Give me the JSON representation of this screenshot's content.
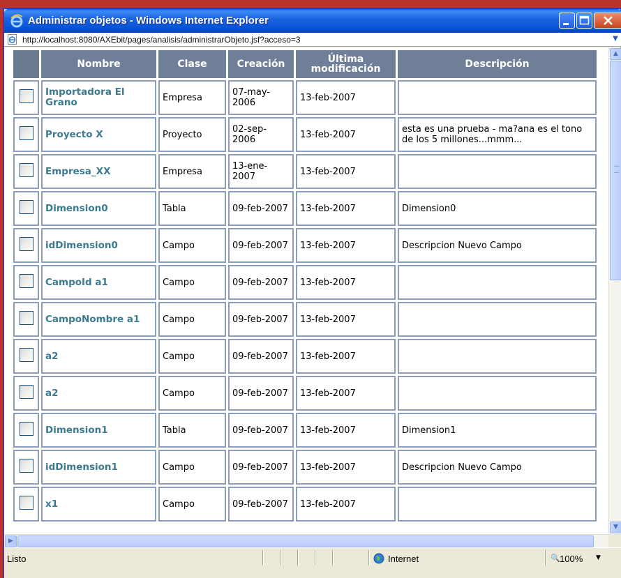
{
  "window": {
    "title": "Administrar objetos - Windows Internet Explorer"
  },
  "address": {
    "url": "http://localhost:8080/AXEbit/pages/analisis/administrarObjeto.jsf?acceso=3"
  },
  "table": {
    "headers": {
      "nombre": "Nombre",
      "clase": "Clase",
      "creacion": "Creación",
      "ultima_modificacion": "Última modificación",
      "descripcion": "Descripción"
    },
    "rows": [
      {
        "nombre": "Importadora El Grano",
        "clase": "Empresa",
        "creacion": "07-may-2006",
        "modificacion": "13-feb-2007",
        "descripcion": ""
      },
      {
        "nombre": "Proyecto X",
        "clase": "Proyecto",
        "creacion": "02-sep-2006",
        "modificacion": "13-feb-2007",
        "descripcion": "esta es una prueba - ma?ana es el tono de los 5 millones...mmm..."
      },
      {
        "nombre": "Empresa_XX",
        "clase": "Empresa",
        "creacion": "13-ene-2007",
        "modificacion": "13-feb-2007",
        "descripcion": ""
      },
      {
        "nombre": "Dimension0",
        "clase": "Tabla",
        "creacion": "09-feb-2007",
        "modificacion": "13-feb-2007",
        "descripcion": "Dimension0"
      },
      {
        "nombre": "idDimension0",
        "clase": "Campo",
        "creacion": "09-feb-2007",
        "modificacion": "13-feb-2007",
        "descripcion": "Descripcion Nuevo Campo"
      },
      {
        "nombre": "CampoId a1",
        "clase": "Campo",
        "creacion": "09-feb-2007",
        "modificacion": "13-feb-2007",
        "descripcion": ""
      },
      {
        "nombre": "CampoNombre a1",
        "clase": "Campo",
        "creacion": "09-feb-2007",
        "modificacion": "13-feb-2007",
        "descripcion": ""
      },
      {
        "nombre": "a2",
        "clase": "Campo",
        "creacion": "09-feb-2007",
        "modificacion": "13-feb-2007",
        "descripcion": ""
      },
      {
        "nombre": "a2",
        "clase": "Campo",
        "creacion": "09-feb-2007",
        "modificacion": "13-feb-2007",
        "descripcion": ""
      },
      {
        "nombre": "Dimension1",
        "clase": "Tabla",
        "creacion": "09-feb-2007",
        "modificacion": "13-feb-2007",
        "descripcion": "Dimension1"
      },
      {
        "nombre": "idDimension1",
        "clase": "Campo",
        "creacion": "09-feb-2007",
        "modificacion": "13-feb-2007",
        "descripcion": "Descripcion Nuevo Campo"
      },
      {
        "nombre": "x1",
        "clase": "Campo",
        "creacion": "09-feb-2007",
        "modificacion": "13-feb-2007",
        "descripcion": ""
      }
    ]
  },
  "status": {
    "text": "Listo",
    "zone": "Internet",
    "zoom": "100%"
  }
}
